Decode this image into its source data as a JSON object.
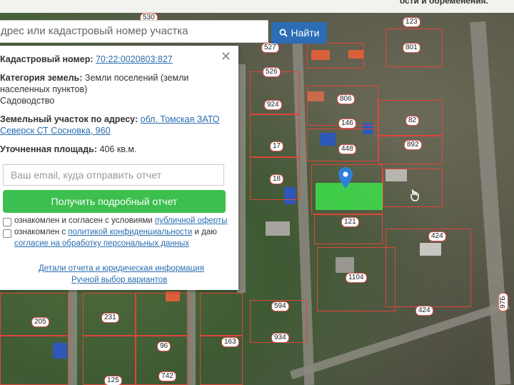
{
  "top_banner": {
    "text": "ости и обременения."
  },
  "search": {
    "value": "дрес или кадастровый номер участка",
    "button_label": "Найти"
  },
  "panel": {
    "cadastral_label": "Кадастровый номер:",
    "cadastral_value": "70:22:0020803:827",
    "category_label": "Категория земель:",
    "category_value_1": "Земли поселений (земли",
    "category_value_2": "населенных пунктов)",
    "category_value_3": "Садоводство",
    "address_label": "Земельный участок по адресу:",
    "address_value_1": "обл. Томская ЗАТО",
    "address_value_2": "Северск СТ Сосновка, 960",
    "area_label": "Уточненная площадь:",
    "area_value": "406 кв.м.",
    "email_placeholder": "Ваш email, куда отправить отчет",
    "cta_label": "Получить подробный отчет",
    "consent1_text": "ознакомлен и согласен с условиями",
    "consent1_link": "публичной оферты",
    "consent2_text": "ознакомлен с",
    "consent2_link": "политикой конфиденциальности",
    "consent2_tail": "и даю",
    "consent2_link2": "согласие на обработку персональных данных",
    "link_details": "Детали отчета и юридическая информация",
    "link_manual": "Ручной выбор вариантов"
  },
  "map": {
    "labels": [
      {
        "t": "530"
      },
      {
        "t": "123"
      },
      {
        "t": "527"
      },
      {
        "t": "801"
      },
      {
        "t": "526"
      },
      {
        "t": "806"
      },
      {
        "t": "924"
      },
      {
        "t": "82"
      },
      {
        "t": "146"
      },
      {
        "t": "17"
      },
      {
        "t": "448"
      },
      {
        "t": "892"
      },
      {
        "t": "18"
      },
      {
        "t": "121"
      },
      {
        "t": "424"
      },
      {
        "t": "1104"
      },
      {
        "t": "205"
      },
      {
        "t": "231"
      },
      {
        "t": "594"
      },
      {
        "t": "424"
      },
      {
        "t": "96"
      },
      {
        "t": "163"
      },
      {
        "t": "934"
      },
      {
        "t": "742"
      },
      {
        "t": "125"
      },
      {
        "t": "97Б"
      }
    ]
  }
}
